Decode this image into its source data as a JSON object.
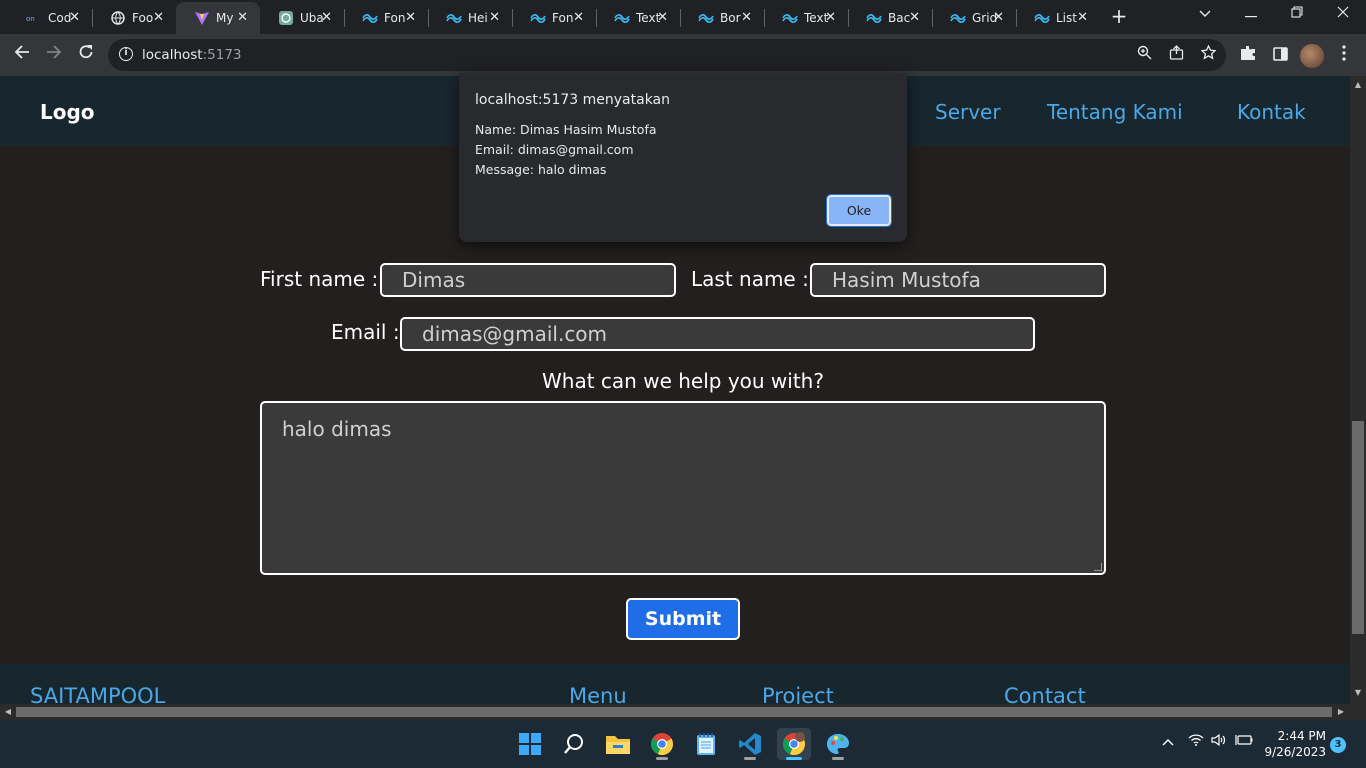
{
  "browser": {
    "tabs": [
      {
        "title": "Cod",
        "icon": "codepen-icon"
      },
      {
        "title": "Foo",
        "icon": "globe-icon"
      },
      {
        "title": "My",
        "icon": "vite-icon",
        "active": true
      },
      {
        "title": "Uba",
        "icon": "chatgpt-icon"
      },
      {
        "title": "Fon",
        "icon": "tailwind-icon"
      },
      {
        "title": "Hei",
        "icon": "tailwind-icon"
      },
      {
        "title": "Fon",
        "icon": "tailwind-icon"
      },
      {
        "title": "Text",
        "icon": "tailwind-icon"
      },
      {
        "title": "Bor",
        "icon": "tailwind-icon"
      },
      {
        "title": "Text",
        "icon": "tailwind-icon"
      },
      {
        "title": "Bac",
        "icon": "tailwind-icon"
      },
      {
        "title": "Grid",
        "icon": "tailwind-icon"
      },
      {
        "title": "List",
        "icon": "tailwind-icon"
      }
    ],
    "new_tab": "+",
    "url_host": "localhost",
    "url_port": ":5173"
  },
  "site": {
    "logo": "Logo",
    "nav": [
      "Server",
      "Tentang Kami",
      "Kontak"
    ],
    "accent": "#4aa8e8"
  },
  "form": {
    "first_name_label": "First name :",
    "first_name_value": "Dimas",
    "last_name_label": "Last name :",
    "last_name_value": "Hasim Mustofa",
    "email_label": "Email :",
    "email_value": "dimas@gmail.com",
    "help_label": "What can we help you with?",
    "message_value": "halo dimas",
    "submit_label": "Submit",
    "submit_color": "#1f6ee8"
  },
  "footer": {
    "items": [
      "SAITAMPOOL",
      "Menu",
      "Project",
      "Contact"
    ]
  },
  "dialog": {
    "title": "localhost:5173 menyatakan",
    "lines": [
      "Name: Dimas Hasim Mustofa",
      "Email: dimas@gmail.com",
      "Message: halo dimas"
    ],
    "ok_label": "Oke"
  },
  "taskbar": {
    "time": "2:44 PM",
    "date": "9/26/2023",
    "notification_count": "3"
  }
}
